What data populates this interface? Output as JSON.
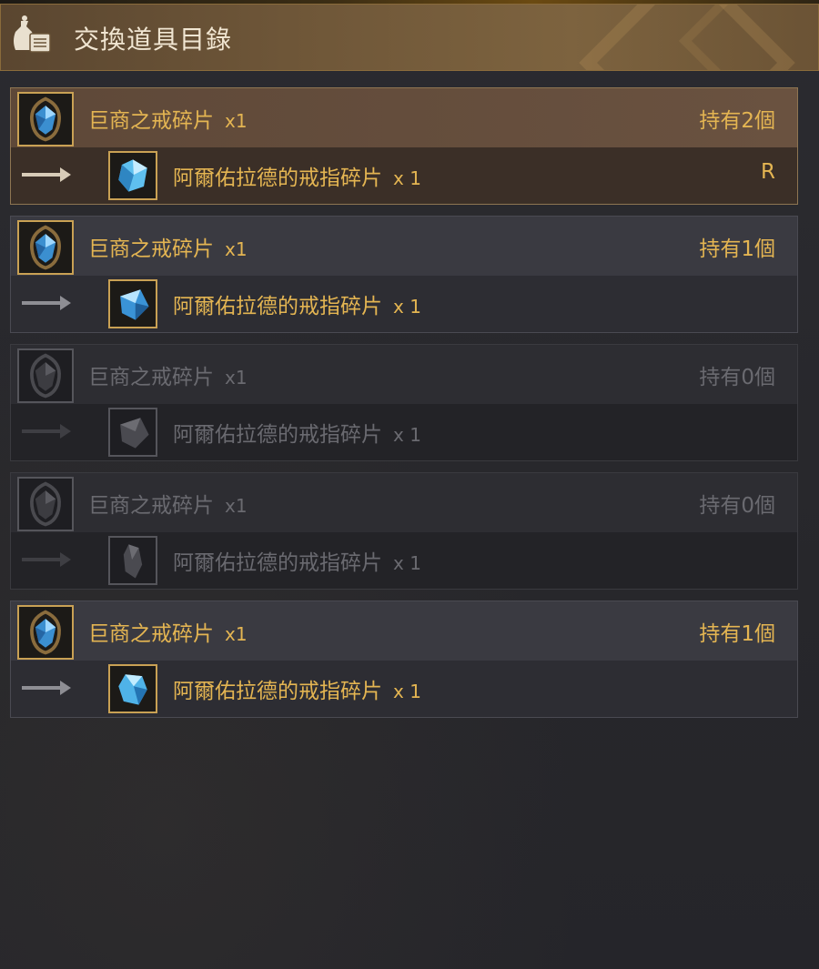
{
  "header": {
    "title": "交換道具目錄",
    "icon": "bag-scroll-icon"
  },
  "colors": {
    "accent_gold": "#e4b552",
    "disabled_text": "#6a6a70",
    "slot_border": "#c9a154"
  },
  "entries": [
    {
      "state": "selected",
      "source_name": "巨商之戒碎片",
      "source_qty": "x1",
      "held": "持有2個",
      "target_name": "阿爾佑拉德的戒指碎片",
      "target_qty": "x 1",
      "grade": "R",
      "source_icon": "blue-crystal-ring-shard-icon",
      "target_icon": "blue-cube-shard-icon"
    },
    {
      "state": "normal",
      "source_name": "巨商之戒碎片",
      "source_qty": "x1",
      "held": "持有1個",
      "target_name": "阿爾佑拉德的戒指碎片",
      "target_qty": "x 1",
      "grade": "",
      "source_icon": "blue-crystal-ring-shard-icon",
      "target_icon": "blue-faceted-shard-icon"
    },
    {
      "state": "disabled",
      "source_name": "巨商之戒碎片",
      "source_qty": "x1",
      "held": "持有0個",
      "target_name": "阿爾佑拉德的戒指碎片",
      "target_qty": "x 1",
      "grade": "",
      "source_icon": "gray-ring-shard-icon",
      "target_icon": "gray-faceted-shard-icon"
    },
    {
      "state": "disabled",
      "source_name": "巨商之戒碎片",
      "source_qty": "x1",
      "held": "持有0個",
      "target_name": "阿爾佑拉德的戒指碎片",
      "target_qty": "x 1",
      "grade": "",
      "source_icon": "gray-ring-shard-icon",
      "target_icon": "gray-splinter-shard-icon"
    },
    {
      "state": "normal",
      "source_name": "巨商之戒碎片",
      "source_qty": "x1",
      "held": "持有1個",
      "target_name": "阿爾佑拉德的戒指碎片",
      "target_qty": "x 1",
      "grade": "",
      "source_icon": "blue-crystal-ring-shard-icon",
      "target_icon": "blue-gem-shard-icon"
    }
  ]
}
